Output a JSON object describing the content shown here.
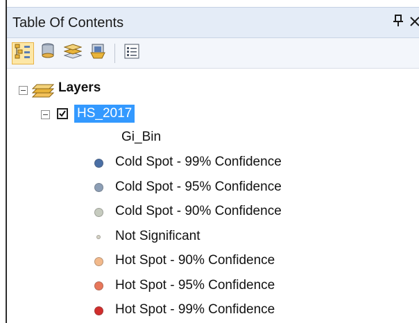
{
  "panel": {
    "title": "Table Of Contents",
    "pin_glyph": "ք",
    "close_glyph": "✕"
  },
  "toolbar": {
    "buttons": [
      {
        "icon": "list-by-drawing-order-icon",
        "active": true
      },
      {
        "icon": "list-by-source-icon",
        "active": false
      },
      {
        "icon": "list-by-visibility-icon",
        "active": false
      },
      {
        "icon": "list-by-selection-icon",
        "active": false
      },
      {
        "icon": "options-icon",
        "active": false
      }
    ]
  },
  "tree": {
    "root_label": "Layers",
    "layer": {
      "name": "HS_2017",
      "checked": true,
      "field": "Gi_Bin",
      "classes": [
        {
          "label": "Cold Spot - 99% Confidence",
          "color": "#4a6fa5"
        },
        {
          "label": "Cold Spot - 95% Confidence",
          "color": "#8c9eb5"
        },
        {
          "label": "Cold Spot - 90% Confidence",
          "color": "#c6cbbf"
        },
        {
          "label": "Not Significant",
          "color": "#d5d2c4"
        },
        {
          "label": "Hot Spot - 90% Confidence",
          "color": "#f2b98b"
        },
        {
          "label": "Hot Spot - 95% Confidence",
          "color": "#e8775a"
        },
        {
          "label": "Hot Spot - 99% Confidence",
          "color": "#d12d2c"
        }
      ]
    }
  }
}
